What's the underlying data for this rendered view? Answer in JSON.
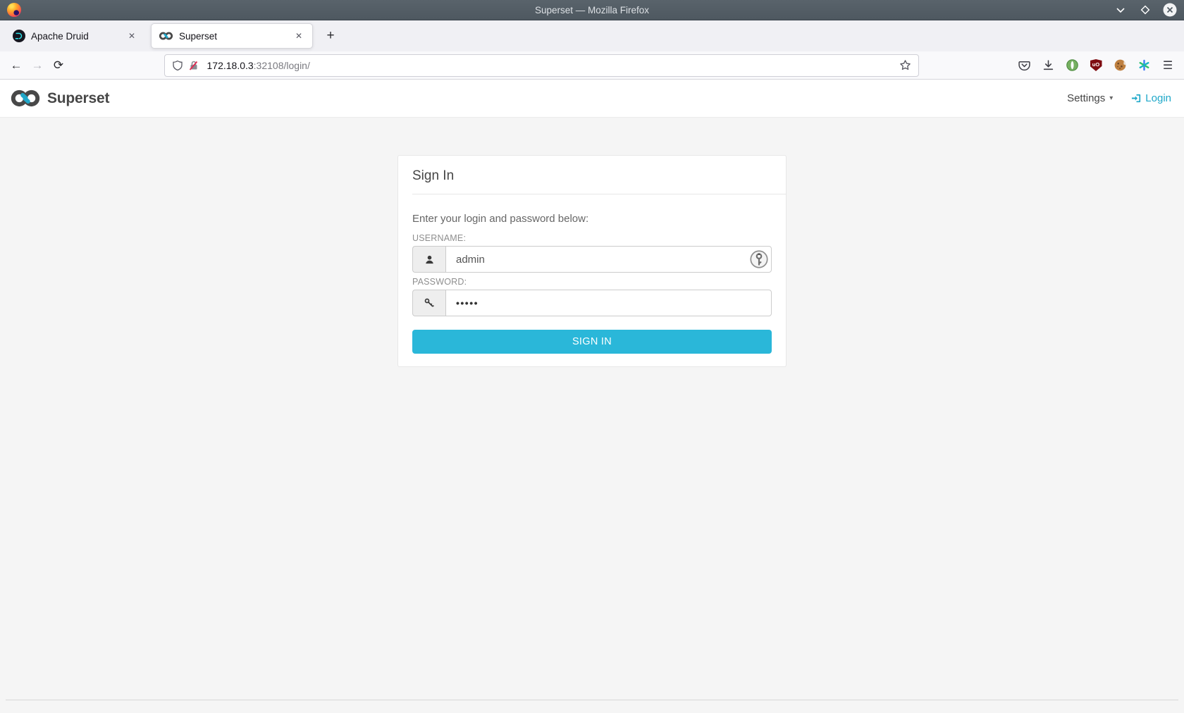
{
  "window": {
    "title": "Superset — Mozilla Firefox"
  },
  "icons": {
    "back": "←",
    "forward": "→",
    "reload": "⟳",
    "new_tab": "+",
    "close_tab": "✕",
    "menu": "☰",
    "caret_down": "▾",
    "ublock_badge": "uO"
  },
  "browser": {
    "tabs": [
      {
        "title": "Apache Druid",
        "active": false
      },
      {
        "title": "Superset",
        "active": true
      }
    ],
    "url": {
      "host": "172.18.0.3",
      "path": ":32108/login/"
    }
  },
  "superset_nav": {
    "brand": "Superset",
    "settings_label": "Settings",
    "login_label": "Login"
  },
  "login_card": {
    "title": "Sign In",
    "instruction": "Enter your login and password below:",
    "username_label": "USERNAME:",
    "username_value": "admin",
    "password_label": "PASSWORD:",
    "password_masked": "•••••",
    "submit_label": "SIGN IN"
  },
  "colors": {
    "accent": "#20a7c9",
    "button": "#2ab7d9",
    "link": "#1fa8c9",
    "titlebar": "#4e5860",
    "content_bg": "#f5f5f5",
    "ublock": "#7f0c12"
  }
}
